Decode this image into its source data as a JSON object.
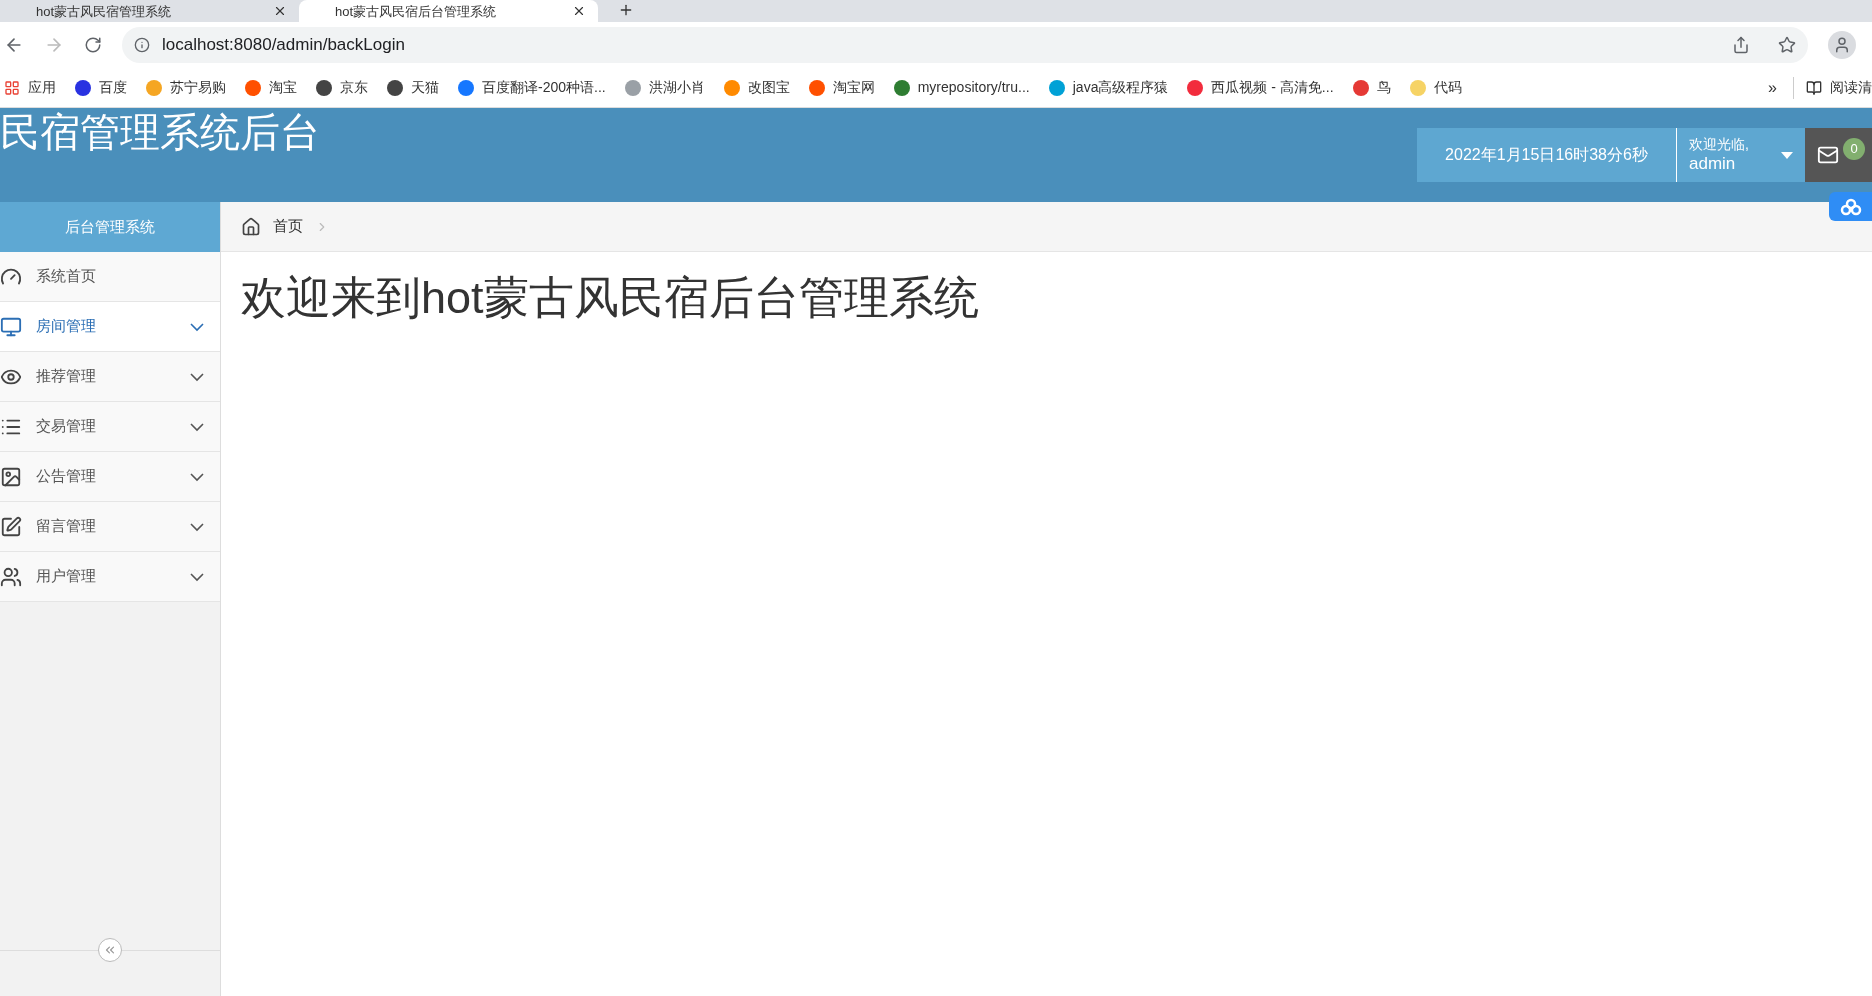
{
  "browser": {
    "tabs": [
      {
        "title": "hot蒙古风民宿管理系统",
        "selected": false
      },
      {
        "title": "hot蒙古风民宿后台管理系统",
        "selected": true
      }
    ],
    "address": "localhost:8080/admin/backLogin",
    "bookmarks": [
      {
        "label": "应用",
        "color": "#e94235"
      },
      {
        "label": "百度",
        "color": "#2932e1"
      },
      {
        "label": "苏宁易购",
        "color": "#f5a623"
      },
      {
        "label": "淘宝",
        "color": "#ff5000"
      },
      {
        "label": "京东",
        "color": "#444444"
      },
      {
        "label": "天猫",
        "color": "#444444"
      },
      {
        "label": "百度翻译-200种语...",
        "color": "#1677ff"
      },
      {
        "label": "洪湖小肖",
        "color": "#9aa0a6"
      },
      {
        "label": "改图宝",
        "color": "#ff8a00"
      },
      {
        "label": "淘宝网",
        "color": "#ff5000"
      },
      {
        "label": "myrepository/tru...",
        "color": "#2e7d32"
      },
      {
        "label": "java高级程序猿",
        "color": "#00a1d6"
      },
      {
        "label": "西瓜视频 - 高清免...",
        "color": "#f22c3d"
      },
      {
        "label": "鸟",
        "color": "#e53935"
      },
      {
        "label": "代码",
        "color": "#f6d365"
      }
    ],
    "more": "»",
    "reading_list": "阅读清"
  },
  "header": {
    "title": "民宿管理系统后台",
    "datetime": "2022年1月15日16时38分6秒",
    "greeting": "欢迎光临,",
    "user": "admin",
    "mail_count": "0"
  },
  "sidebar": {
    "title": "后台管理系统",
    "items": [
      {
        "label": "系统首页",
        "selected": false,
        "has_submenu": false
      },
      {
        "label": "房间管理",
        "selected": true,
        "has_submenu": true
      },
      {
        "label": "推荐管理",
        "selected": false,
        "has_submenu": true
      },
      {
        "label": "交易管理",
        "selected": false,
        "has_submenu": true
      },
      {
        "label": "公告管理",
        "selected": false,
        "has_submenu": true
      },
      {
        "label": "留言管理",
        "selected": false,
        "has_submenu": true
      },
      {
        "label": "用户管理",
        "selected": false,
        "has_submenu": true
      }
    ]
  },
  "breadcrumb": [
    "首页"
  ],
  "main": {
    "heading": "欢迎来到hot蒙古风民宿后台管理系统"
  }
}
